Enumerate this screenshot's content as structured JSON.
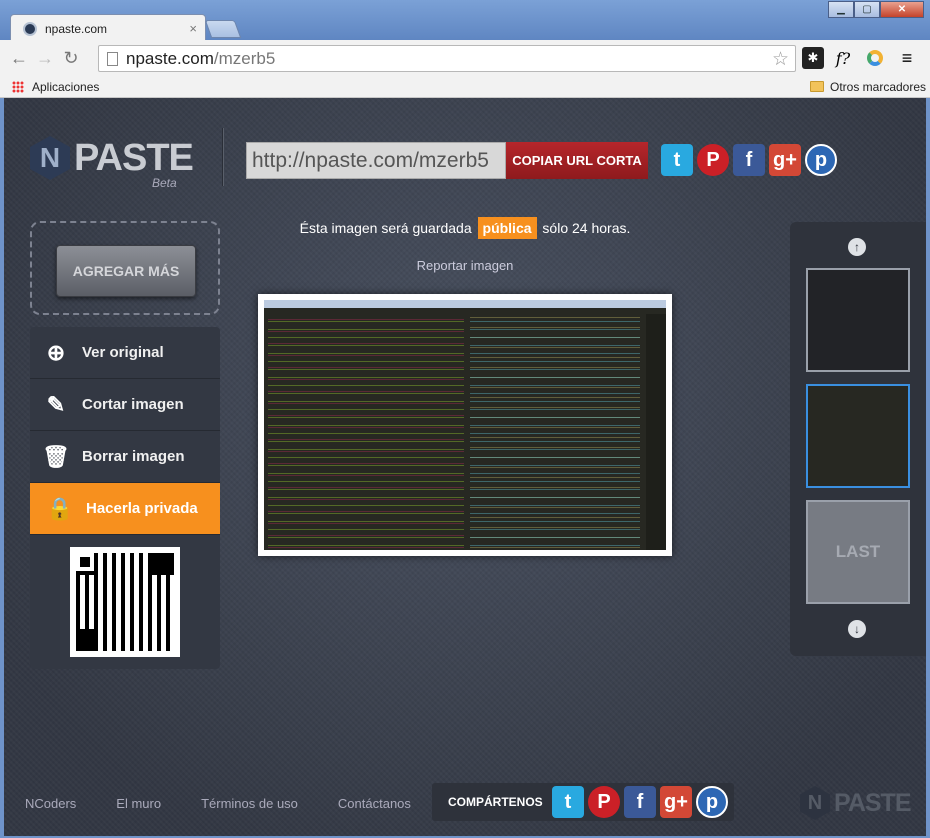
{
  "browser": {
    "tab_title": "npaste.com",
    "tab_close": "×",
    "url_host": "npaste.com",
    "url_path": "/mzerb5",
    "bookmarks": {
      "apps": "Aplicaciones",
      "other": "Otros marcadores"
    },
    "icons": [
      "back-icon",
      "forward-icon",
      "reload-icon",
      "star-icon",
      "menu-icon"
    ]
  },
  "header": {
    "logo_letter": "N",
    "logo_text": "PASTE",
    "logo_beta": "Beta",
    "short_url": "http://npaste.com/mzerb5",
    "copy_label": "COPIAR URL CORTA"
  },
  "left_panel": {
    "add_more": "AGREGAR MÁS",
    "menu": [
      {
        "label": "Ver original",
        "icon": "zoom-in-icon"
      },
      {
        "label": "Cortar imagen",
        "icon": "edit-icon"
      },
      {
        "label": "Borrar imagen",
        "icon": "trash-icon"
      },
      {
        "label": "Hacerla privada",
        "icon": "lock-icon"
      }
    ]
  },
  "main": {
    "notice_before": "Ésta imagen será guardada",
    "notice_badge": "pública",
    "notice_after": "sólo 24 horas.",
    "report": "Reportar imagen"
  },
  "thumbs": {
    "last_label": "LAST"
  },
  "footer": {
    "links": [
      "NCoders",
      "El muro",
      "Términos de uso",
      "Contáctanos"
    ],
    "share_label": "COMPÁRTENOS",
    "logo_letter": "N",
    "logo_text": "PASTE"
  },
  "colors": {
    "accent": "#f7901e",
    "copy_button": "#a32024",
    "selected_thumb": "#3a8fe0"
  }
}
